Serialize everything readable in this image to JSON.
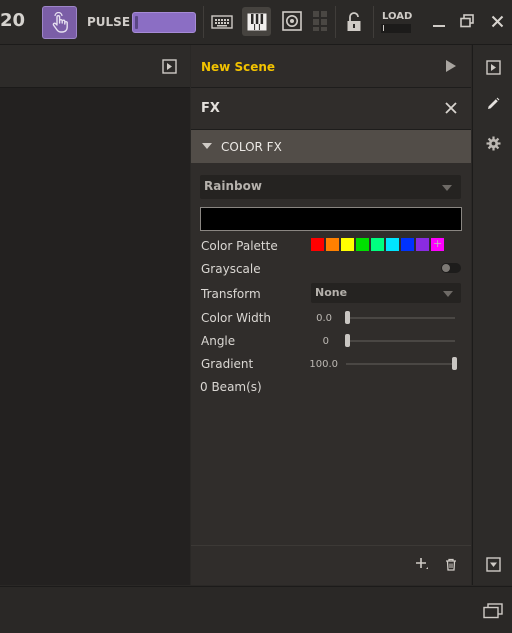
{
  "topbar": {
    "counter_fragment": "20",
    "pulse_label": "PULSE",
    "load_label": "LOAD",
    "colors": {
      "accent": "#7b5ea7",
      "pulse_fill": "#8b6ec4"
    }
  },
  "scene": {
    "title": "New Scene",
    "fx_title": "FX",
    "section_title": "COLOR FX",
    "preset_select": "Rainbow",
    "rows": {
      "color_palette_label": "Color Palette",
      "grayscale_label": "Grayscale",
      "transform_label": "Transform",
      "transform_value": "None",
      "color_width_label": "Color Width",
      "color_width_value": "0.0",
      "angle_label": "Angle",
      "angle_value": "0",
      "gradient_label": "Gradient",
      "gradient_value": "100.0"
    },
    "palette": [
      "#ff0000",
      "#ff8000",
      "#ffff00",
      "#00e000",
      "#00ff80",
      "#00e5ff",
      "#0033ff",
      "#8a2be2",
      "#ff00ff"
    ],
    "palette_add": "+",
    "beams_label": "0 Beam(s)",
    "title_color": "#f2c200"
  },
  "icons": {
    "touch": "hand-touch-icon",
    "keyboard": "keyboard-icon",
    "piano": "piano-icon",
    "speaker": "speaker-icon",
    "grid": "grid-icon",
    "lock": "unlock-icon",
    "minimize": "minimize-icon",
    "restore": "restore-icon",
    "close": "close-icon",
    "play": "play-icon",
    "pencil": "pencil-icon",
    "gear": "gear-icon",
    "add": "add-icon",
    "trash": "trash-icon",
    "expand": "expand-icon",
    "windows": "windows-icon"
  }
}
